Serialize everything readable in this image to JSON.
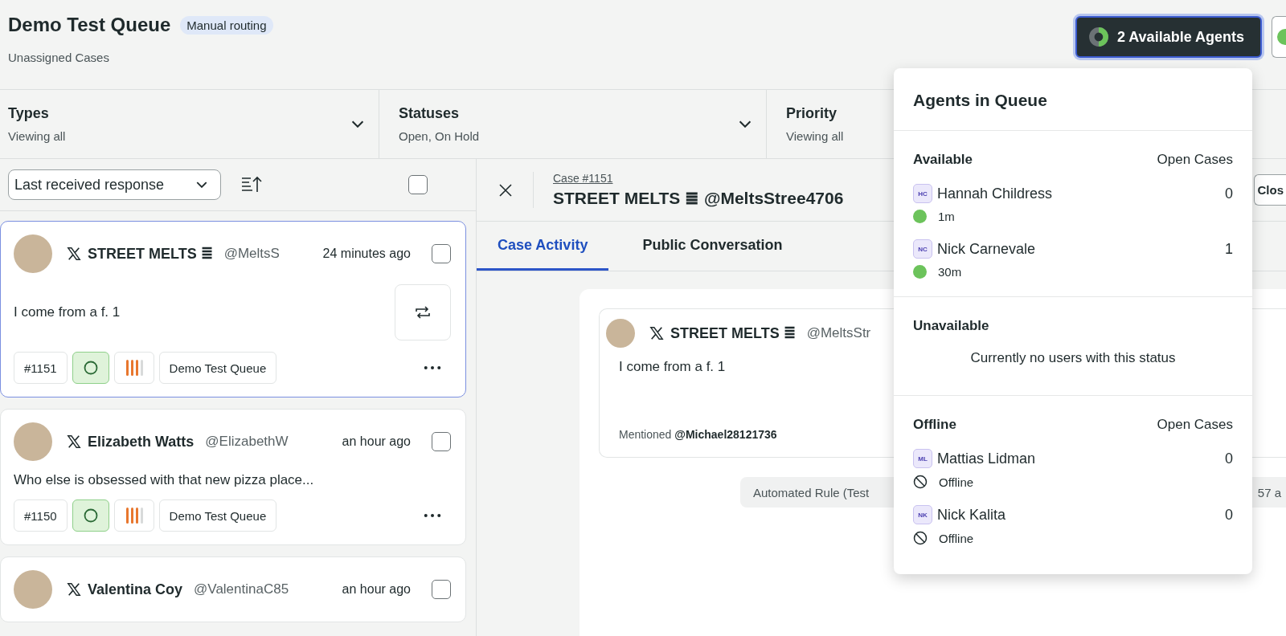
{
  "header": {
    "title": "Demo Test Queue",
    "badge": "Manual routing",
    "subtitle": "Unassigned Cases"
  },
  "agents_button": {
    "label": "2 Available Agents"
  },
  "filters": [
    {
      "label": "Types",
      "value": "Viewing all"
    },
    {
      "label": "Statuses",
      "value": "Open, On Hold"
    },
    {
      "label": "Priority",
      "value": "Viewing all"
    }
  ],
  "sort": {
    "value": "Last received response",
    "select_all_checked": false
  },
  "cases": [
    {
      "name": "STREET MELTS ≣",
      "handle": "@MeltsS",
      "time": "24 minutes ago",
      "message": "I come from a f. 1",
      "number": "#1151",
      "queue": "Demo Test Queue",
      "selected": true,
      "checked": false,
      "repost": true
    },
    {
      "name": "Elizabeth Watts",
      "handle": "@ElizabethW",
      "time": "an hour ago",
      "message": "Who else is obsessed with that new pizza place...",
      "number": "#1150",
      "queue": "Demo Test Queue",
      "selected": false,
      "checked": false,
      "repost": false
    },
    {
      "name": "Valentina Coy",
      "handle": "@ValentinaC85",
      "time": "an hour ago",
      "selected": false,
      "checked": false
    }
  ],
  "detail": {
    "case_label": "Case #1151",
    "title": "STREET MELTS ≣ @MeltsStree4706",
    "action": "Clos",
    "tabs": [
      {
        "label": "Case Activity",
        "selected": true
      },
      {
        "label": "Public Conversation",
        "selected": false
      }
    ],
    "post": {
      "name": "STREET MELTS ≣",
      "handle": "@MeltsStr",
      "message": "I come from a f. 1",
      "mention": "Mentioned **@Michael28121736**"
    },
    "event": {
      "text": "Automated Rule (Test",
      "time": "57 a"
    }
  },
  "agents_popup": {
    "title": "Agents in Queue",
    "sections": [
      {
        "title": "Available",
        "column": "Open Cases",
        "agents": [
          {
            "initials": "HC",
            "name": "Hannah Childress",
            "count": "0",
            "status": "1m",
            "kind": "online"
          },
          {
            "initials": "NC",
            "name": "Nick Carnevale",
            "count": "1",
            "status": "30m",
            "kind": "online"
          }
        ]
      },
      {
        "title": "Unavailable",
        "empty": "Currently no users with this status"
      },
      {
        "title": "Offline",
        "column": "Open Cases",
        "agents": [
          {
            "initials": "ML",
            "name": "Mattias Lidman",
            "count": "0",
            "status": "Offline",
            "kind": "offline"
          },
          {
            "initials": "NK",
            "name": "Nick Kalita",
            "count": "0",
            "status": "Offline",
            "kind": "offline"
          }
        ]
      }
    ]
  }
}
